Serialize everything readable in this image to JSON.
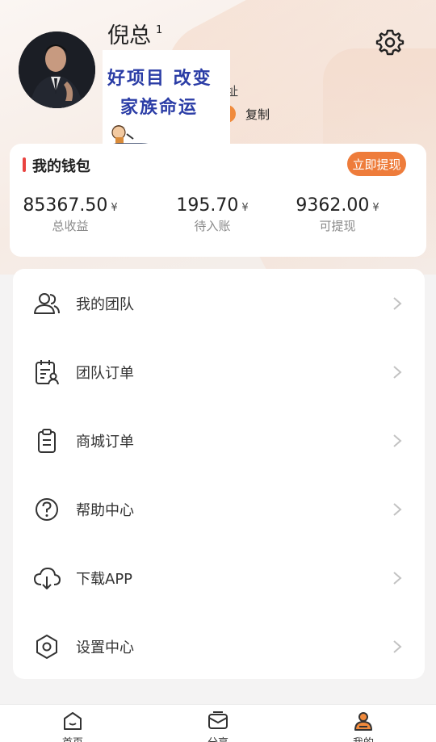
{
  "profile": {
    "name": "倪总",
    "name_suffix": "1",
    "subline_fragment": "址",
    "copy_label": "复制",
    "overlay": {
      "line1": "好项目 改变",
      "line2": "家族命运"
    }
  },
  "wallet": {
    "title": "我的钱包",
    "withdraw_label": "立即提现",
    "currency": "¥",
    "stats": [
      {
        "amount": "85367.50",
        "caption": "总收益"
      },
      {
        "amount": "195.70",
        "caption": "待入账"
      },
      {
        "amount": "9362.00",
        "caption": "可提现"
      }
    ]
  },
  "menu": {
    "items": [
      {
        "label": "我的团队",
        "icon": "team-icon"
      },
      {
        "label": "团队订单",
        "icon": "team-order-icon"
      },
      {
        "label": "商城订单",
        "icon": "clipboard-icon"
      },
      {
        "label": "帮助中心",
        "icon": "help-icon"
      },
      {
        "label": "下载APP",
        "icon": "cloud-download-icon"
      },
      {
        "label": "设置中心",
        "icon": "settings-hexagon-icon"
      }
    ]
  },
  "tabbar": {
    "tabs": [
      {
        "label": "首页",
        "icon": "home-icon"
      },
      {
        "label": "分享",
        "icon": "share-icon"
      },
      {
        "label": "我的",
        "icon": "profile-icon",
        "active": true
      }
    ]
  },
  "colors": {
    "accent": "#ee7c3b",
    "wallet_bar": "#e94340",
    "overlay_text": "#2b3da6"
  }
}
